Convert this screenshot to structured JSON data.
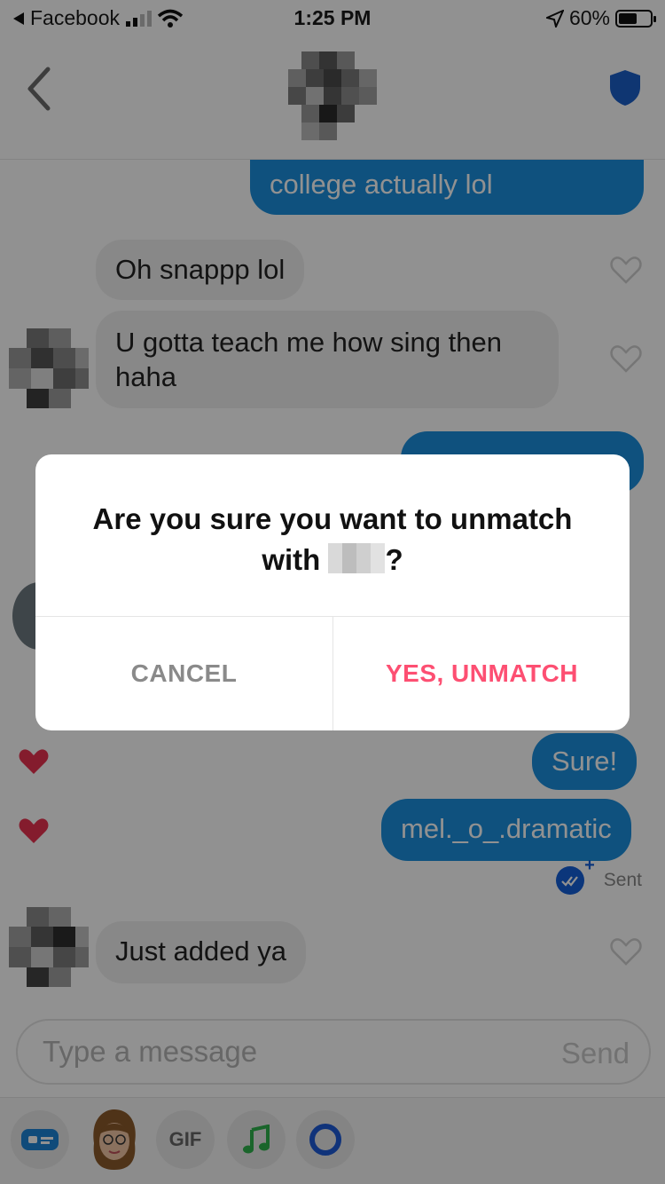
{
  "status_bar": {
    "back_app": "Facebook",
    "time": "1:25 PM",
    "battery_percent": "60%",
    "battery_level": 0.6
  },
  "header": {
    "back_icon": "chevron-left-icon",
    "avatar": "pixelated-avatar",
    "shield_icon": "shield-icon",
    "accent": "#1b5fc9"
  },
  "messages": [
    {
      "direction": "outgoing",
      "text": "college actually lol"
    },
    {
      "direction": "incoming",
      "text": "Oh snappp lol",
      "liked": false
    },
    {
      "direction": "incoming",
      "text": "U gotta teach me how sing then haha",
      "liked": false
    },
    {
      "direction": "outgoing",
      "text": "Sure!",
      "liked": true
    },
    {
      "direction": "outgoing",
      "text": "mel._o_.dramatic",
      "liked": true
    },
    {
      "direction": "incoming",
      "text": "Just added ya",
      "liked": false
    }
  ],
  "receipt": {
    "label": "Sent"
  },
  "composer": {
    "placeholder": "Type a message",
    "send_label": "Send"
  },
  "toolbar": {
    "gif_label": "GIF",
    "icons": [
      "card-icon",
      "bitmoji-icon",
      "gif-icon",
      "music-note-icon",
      "loop-icon"
    ]
  },
  "dialog": {
    "title_prefix": "Are you sure you want to unmatch",
    "title_mid": "with",
    "title_suffix": "?",
    "cancel_label": "CANCEL",
    "confirm_label": "YES, UNMATCH"
  },
  "colors": {
    "outgoing_bubble": "#1b8fde",
    "incoming_bubble": "#efefef",
    "confirm": "#fd4f72",
    "cancel": "#8a8a8a",
    "heart": "#e8324f"
  }
}
